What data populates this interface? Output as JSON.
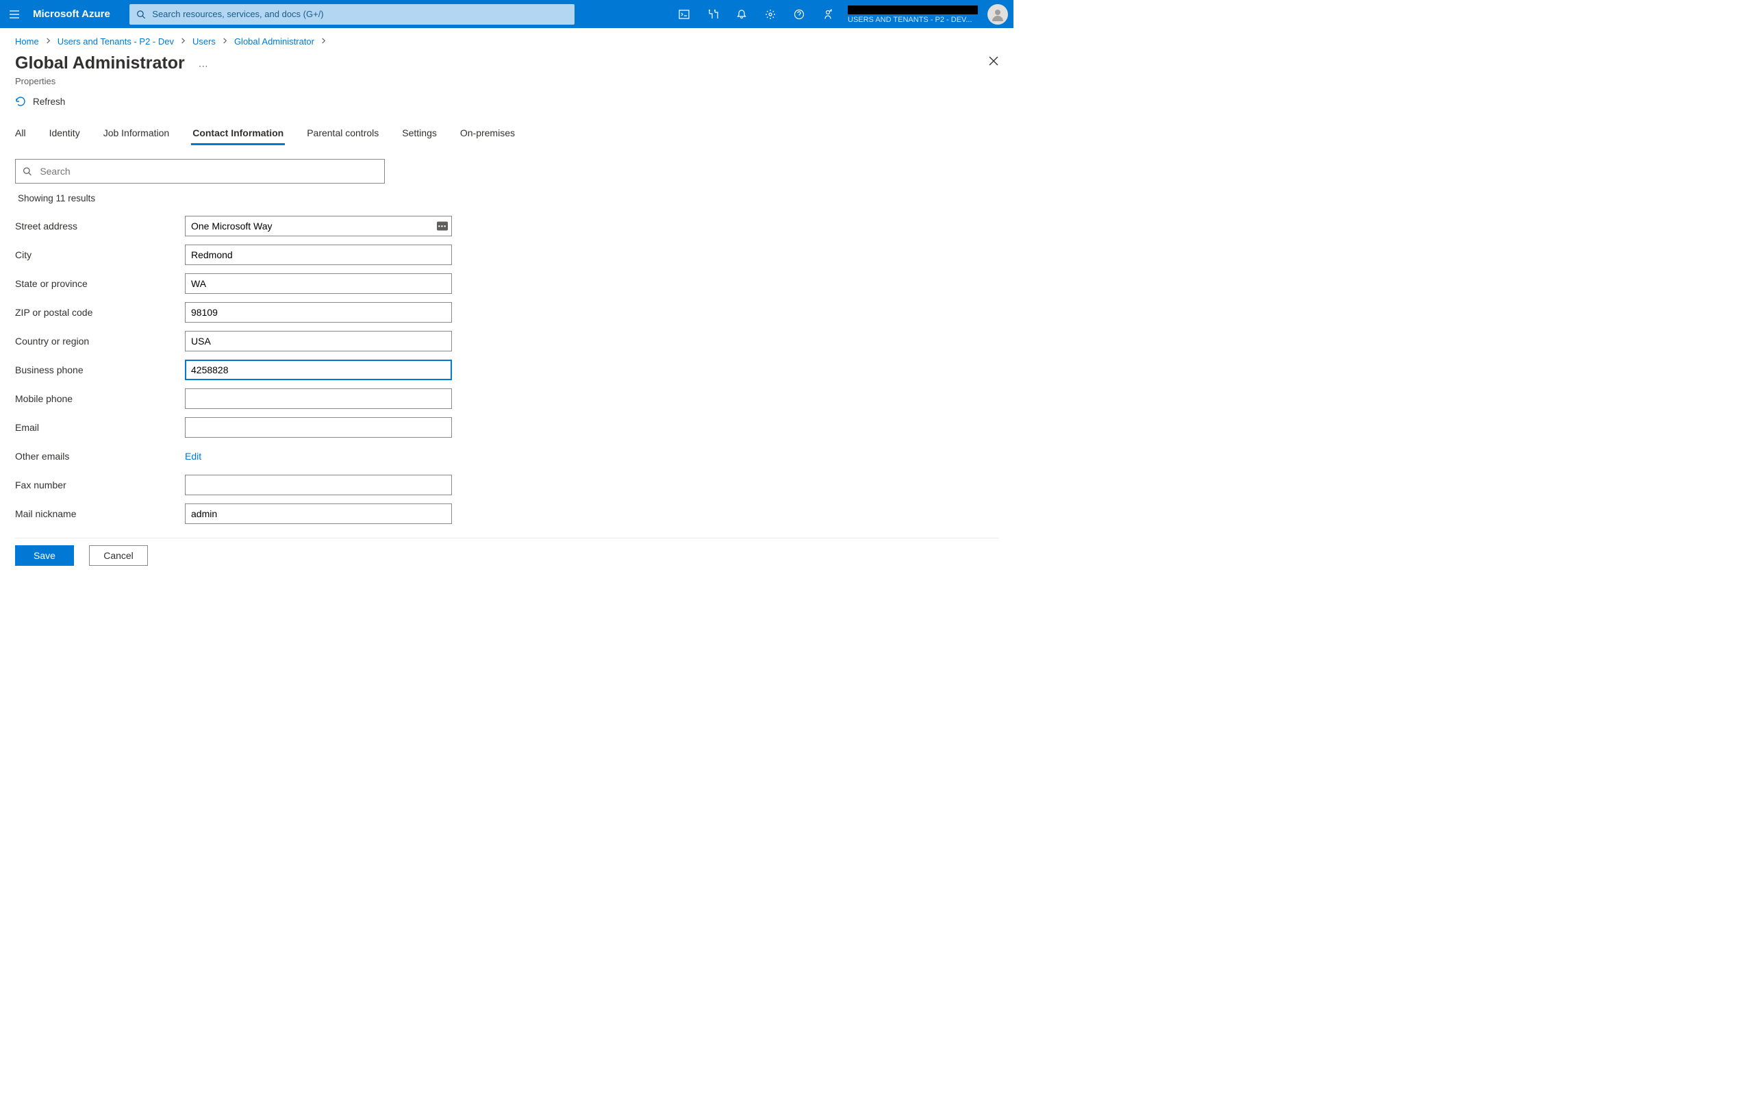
{
  "header": {
    "brand": "Microsoft Azure",
    "search_placeholder": "Search resources, services, and docs (G+/)",
    "tenant_line2": "USERS AND TENANTS - P2 - DEV..."
  },
  "breadcrumb": {
    "items": [
      "Home",
      "Users and Tenants - P2 - Dev",
      "Users",
      "Global Administrator"
    ]
  },
  "page": {
    "title": "Global Administrator",
    "subtitle": "Properties",
    "refresh_label": "Refresh"
  },
  "tabs": [
    "All",
    "Identity",
    "Job Information",
    "Contact Information",
    "Parental controls",
    "Settings",
    "On-premises"
  ],
  "active_tab": "Contact Information",
  "filter": {
    "placeholder": "Search",
    "results_text": "Showing 11 results"
  },
  "form": {
    "fields": [
      {
        "label": "Street address",
        "value": "One Microsoft Way",
        "has_badge": true
      },
      {
        "label": "City",
        "value": "Redmond"
      },
      {
        "label": "State or province",
        "value": "WA"
      },
      {
        "label": "ZIP or postal code",
        "value": "98109"
      },
      {
        "label": "Country or region",
        "value": "USA"
      },
      {
        "label": "Business phone",
        "value": "4258828",
        "focused": true
      },
      {
        "label": "Mobile phone",
        "value": ""
      },
      {
        "label": "Email",
        "value": ""
      },
      {
        "label": "Other emails",
        "link": "Edit"
      },
      {
        "label": "Fax number",
        "value": ""
      },
      {
        "label": "Mail nickname",
        "value": "admin"
      }
    ]
  },
  "footer": {
    "save": "Save",
    "cancel": "Cancel"
  }
}
